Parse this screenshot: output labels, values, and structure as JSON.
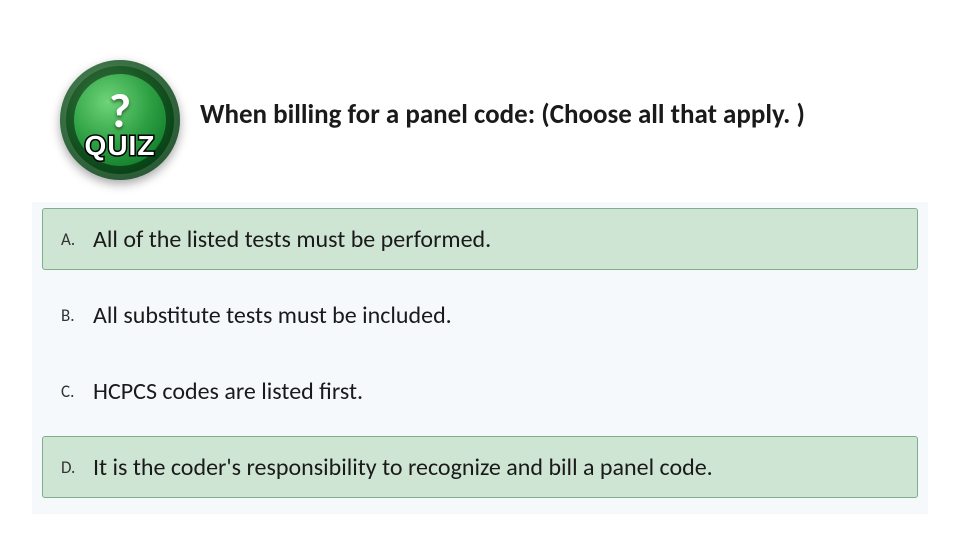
{
  "quiz_icon": {
    "qmark": "?",
    "label": "QUIZ"
  },
  "question": "When billing for a panel code: (Choose all that apply. )",
  "answers": [
    {
      "letter": "A.",
      "text": "All of the listed tests must be performed.",
      "correct": true
    },
    {
      "letter": "B.",
      "text": "All substitute tests must be included.",
      "correct": false
    },
    {
      "letter": "C.",
      "text": "HCPCS codes are listed first.",
      "correct": false
    },
    {
      "letter": "D.",
      "text": "It is the coder's responsibility to recognize and bill a panel code.",
      "correct": true
    }
  ]
}
